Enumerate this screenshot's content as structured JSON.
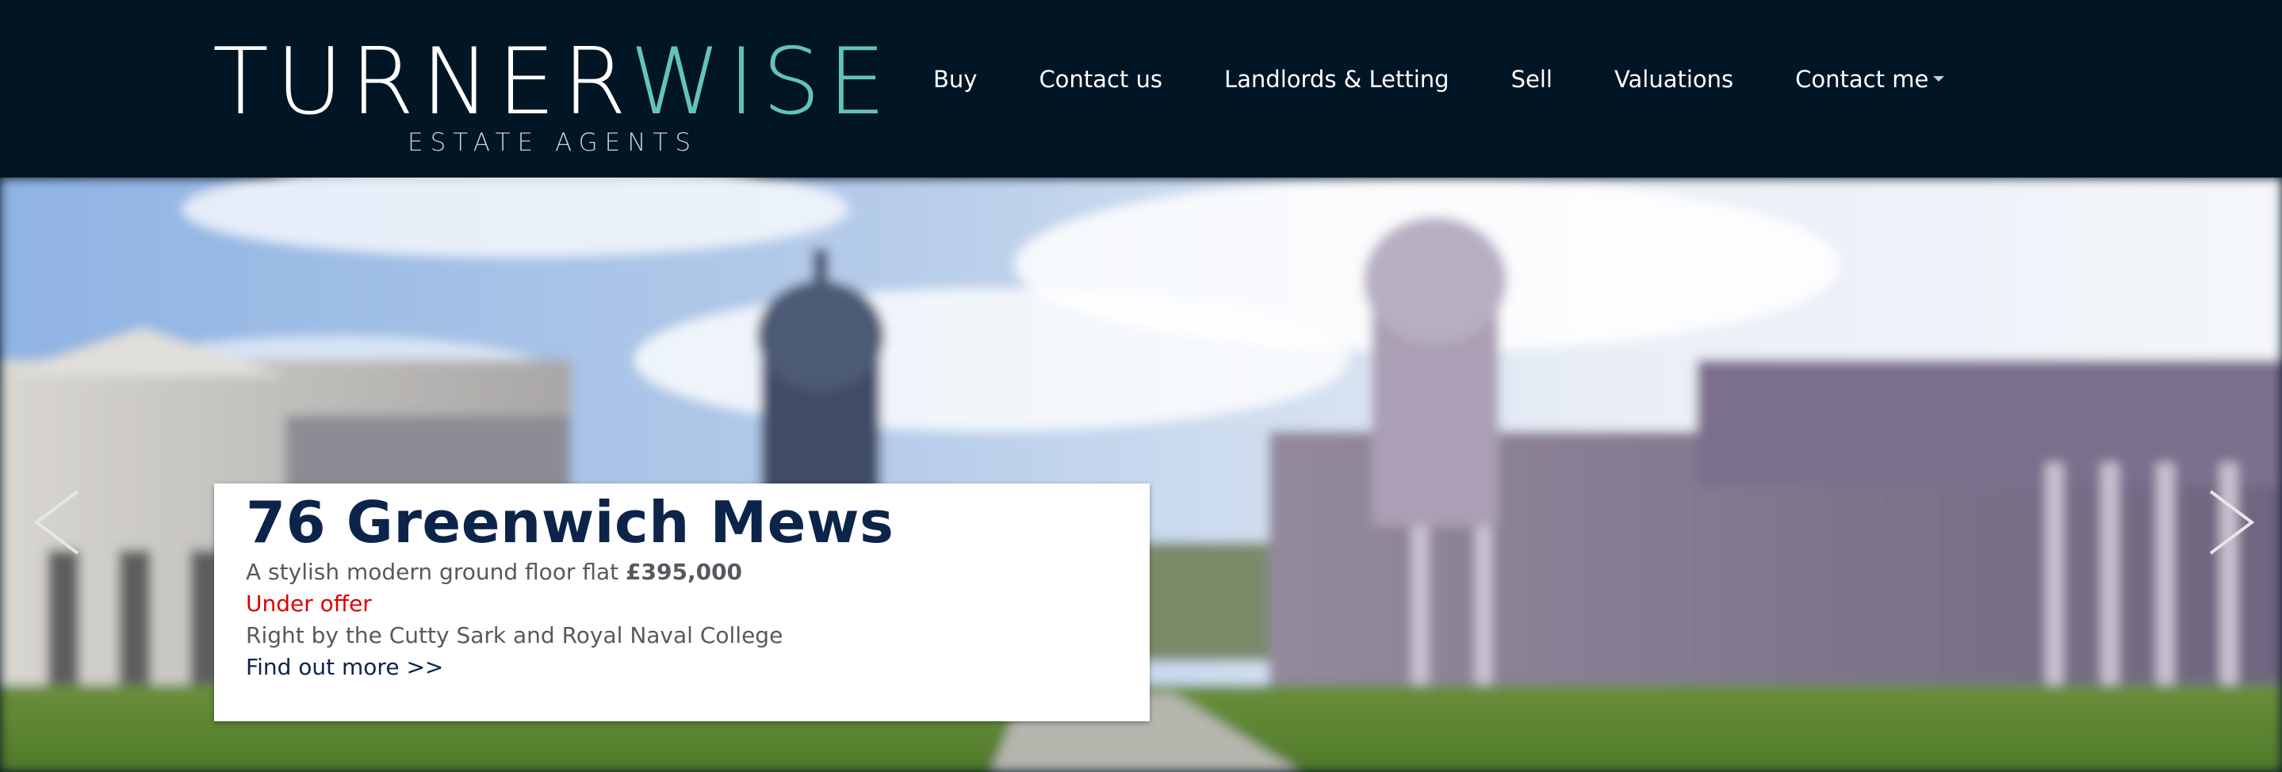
{
  "brand": {
    "name_part1": "TURNER",
    "name_part2": "WISE",
    "tagline": "ESTATE AGENTS",
    "primary_color": "#ffffff",
    "accent_color": "#64c3b9",
    "header_background": "#021525"
  },
  "nav": {
    "items": [
      {
        "label": "Buy"
      },
      {
        "label": "Contact us"
      },
      {
        "label": "Landlords & Letting"
      },
      {
        "label": "Sell"
      },
      {
        "label": "Valuations"
      },
      {
        "label": "Contact me",
        "has_dropdown": true
      }
    ]
  },
  "hero": {
    "property": {
      "title": "76 Greenwich Mews",
      "description": "A stylish modern ground floor flat",
      "price": "£395,000",
      "status": "Under offer",
      "location_note": "Right by the Cutty Sark and Royal Naval College",
      "link_label": "Find out more >>"
    },
    "status_color": "#e00000",
    "title_color": "#0c2449",
    "prev_icon": "chevron-left-icon",
    "next_icon": "chevron-right-icon"
  }
}
